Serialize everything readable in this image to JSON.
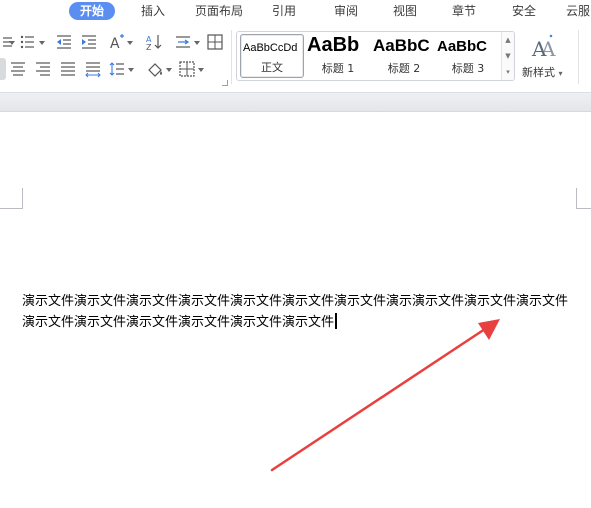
{
  "tabs": [
    {
      "label": "开始",
      "active": true
    },
    {
      "label": "插入"
    },
    {
      "label": "页面布局"
    },
    {
      "label": "引用"
    },
    {
      "label": "审阅"
    },
    {
      "label": "视图"
    },
    {
      "label": "章节"
    },
    {
      "label": "安全"
    },
    {
      "label": "云服"
    }
  ],
  "styles_gallery": {
    "items": [
      {
        "sample": "AaBbCcDd",
        "label": "正文",
        "selected": true
      },
      {
        "sample": "AaBb",
        "label": "标题 1"
      },
      {
        "sample": "AaBbC",
        "label": "标题 2"
      },
      {
        "sample": "AaBbC",
        "label": "标题 3"
      }
    ],
    "new_style_label": "新样式"
  },
  "document": {
    "body_text": "演示文件演示文件演示文件演示文件演示文件演示文件演示文件演示演示文件演示文件演示文件演示文件演示文件演示文件演示文件演示文件演示文件"
  },
  "colors": {
    "active_tab": "#5b8ef1",
    "annotation_arrow": "#e8403f",
    "ribbon_bottom": "#e8eaee"
  },
  "icons": [
    "list-indent-icon",
    "bullet-list-icon",
    "decrease-indent-icon",
    "increase-indent-icon",
    "character-scale-icon",
    "sort-icon",
    "line-spacing-icon",
    "borders-icon",
    "align-center-icon",
    "align-right-icon",
    "justify-icon",
    "distributed-icon",
    "paragraph-spacing-icon",
    "shading-icon",
    "table-borders-icon",
    "new-style-icon"
  ]
}
